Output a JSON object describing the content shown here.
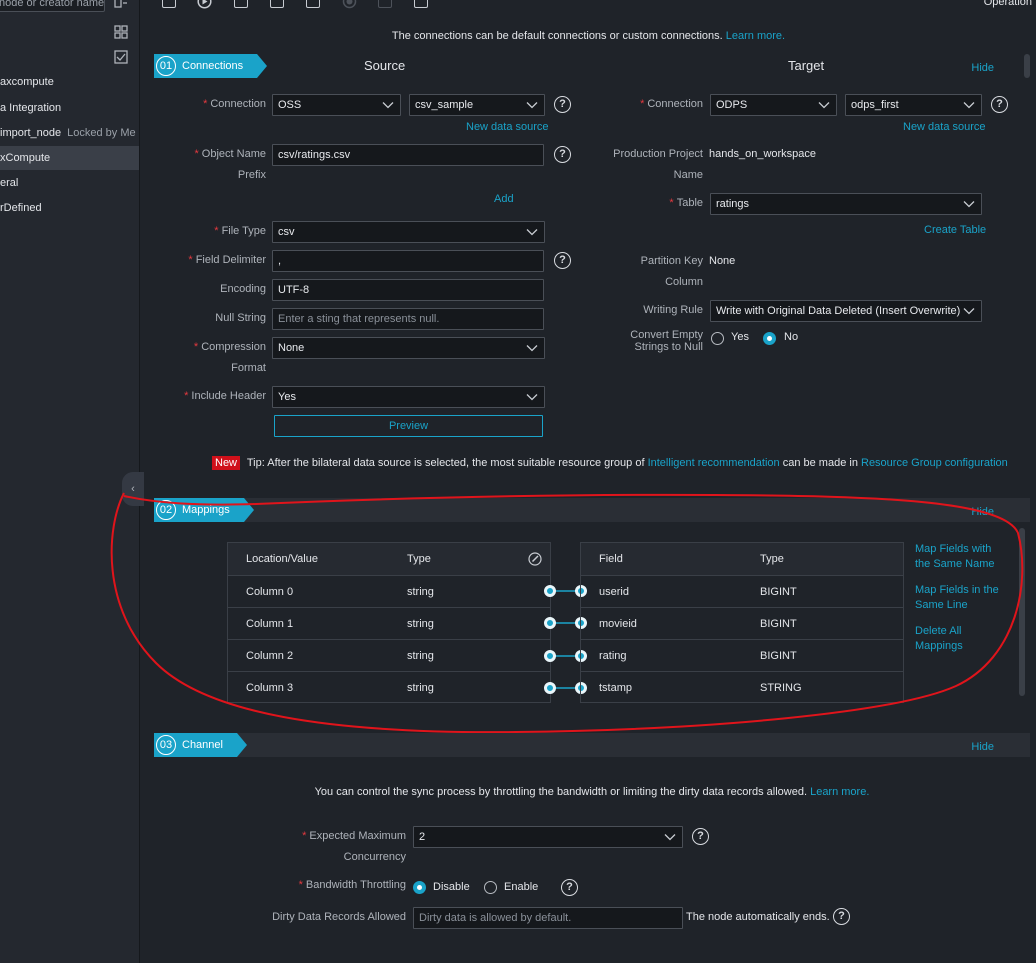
{
  "sidebar": {
    "search_placeholder": "node or creator name",
    "items": [
      {
        "label": "axcompute",
        "sub": ""
      },
      {
        "label": "a Integration",
        "sub": ""
      },
      {
        "label": "import_node",
        "sub": "Locked by Me"
      },
      {
        "label": "xCompute",
        "sub": ""
      },
      {
        "label": "eral",
        "sub": ""
      },
      {
        "label": "rDefined",
        "sub": ""
      }
    ]
  },
  "toolbar": {
    "operation_label": "Operation"
  },
  "intro": {
    "text": "The connections can be default connections or custom connections.",
    "link": "Learn more."
  },
  "connections": {
    "num": "01",
    "title": "Connections",
    "hide": "Hide",
    "source": {
      "heading": "Source",
      "connection_label": "Connection",
      "connection_type": "OSS",
      "connection_name": "csv_sample",
      "new_data_source": "New data source",
      "object_name_label": "Object Name",
      "object_name_label2": "Prefix",
      "object_name": "csv/ratings.csv",
      "add": "Add",
      "file_type_label": "File Type",
      "file_type": "csv",
      "delimiter_label": "Field Delimiter",
      "delimiter": ",",
      "encoding_label": "Encoding",
      "encoding": "UTF-8",
      "null_label": "Null String",
      "null_placeholder": "Enter a sting that represents null.",
      "compression_label": "Compression",
      "compression_label2": "Format",
      "compression": "None",
      "header_label": "Include Header",
      "header": "Yes",
      "preview": "Preview"
    },
    "target": {
      "heading": "Target",
      "connection_label": "Connection",
      "connection_type": "ODPS",
      "connection_name": "odps_first",
      "new_data_source": "New data source",
      "project_label": "Production Project",
      "project_label2": "Name",
      "project": "hands_on_workspace",
      "table_label": "Table",
      "table": "ratings",
      "create_table": "Create Table",
      "partition_label": "Partition Key",
      "partition_label2": "Column",
      "partition": "None",
      "writing_rule_label": "Writing Rule",
      "writing_rule": "Write with Original Data Deleted (Insert Overwrite)",
      "convert_label": "Convert Empty",
      "convert_label2": "Strings to Null",
      "convert_yes": "Yes",
      "convert_no": "No"
    },
    "tip": {
      "badge": "New",
      "text1": "Tip: After the bilateral data source is selected, the most suitable resource group of",
      "link1": "Intelligent recommendation",
      "text2": "can be made in",
      "link2": "Resource Group configuration"
    }
  },
  "mappings": {
    "num": "02",
    "title": "Mappings",
    "hide": "Hide",
    "source_headers": [
      "Location/Value",
      "Type"
    ],
    "target_headers": [
      "Field",
      "Type"
    ],
    "rows": [
      {
        "src": "Column 0",
        "src_type": "string",
        "dst": "userid",
        "dst_type": "BIGINT"
      },
      {
        "src": "Column 1",
        "src_type": "string",
        "dst": "movieid",
        "dst_type": "BIGINT"
      },
      {
        "src": "Column 2",
        "src_type": "string",
        "dst": "rating",
        "dst_type": "BIGINT"
      },
      {
        "src": "Column 3",
        "src_type": "string",
        "dst": "tstamp",
        "dst_type": "STRING"
      }
    ],
    "actions": {
      "same_name_1": "Map Fields with",
      "same_name_2": "the Same Name",
      "same_line_1": "Map Fields in the",
      "same_line_2": "Same Line",
      "delete_1": "Delete All",
      "delete_2": "Mappings"
    }
  },
  "channel": {
    "num": "03",
    "title": "Channel",
    "hide": "Hide",
    "intro": "You can control the sync process by throttling the bandwidth or limiting the dirty data records allowed.",
    "intro_link": "Learn more.",
    "concurrency_label": "Expected Maximum",
    "concurrency_label2": "Concurrency",
    "concurrency": "2",
    "bandwidth_label": "Bandwidth Throttling",
    "bw_disable": "Disable",
    "bw_enable": "Enable",
    "dirty_label": "Dirty Data Records Allowed",
    "dirty_placeholder": "Dirty data is allowed by default.",
    "dirty_suffix": "The node automatically ends."
  },
  "colors": {
    "accent": "#1aa3c9",
    "required": "#e5393f",
    "annotation": "#e0141b",
    "new_badge": "#d0101a"
  }
}
